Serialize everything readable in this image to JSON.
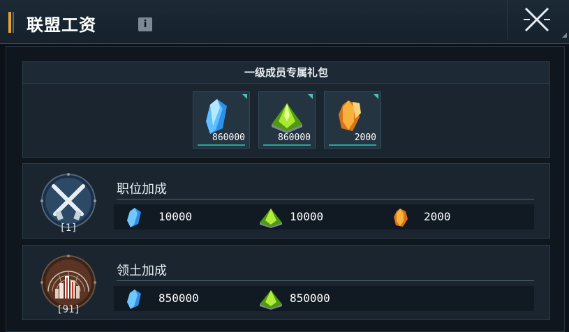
{
  "window": {
    "title": "联盟工资",
    "info_icon": "info-icon",
    "close_icon": "close-icon"
  },
  "gift_pack": {
    "title": "一级成员专属礼包",
    "items": [
      {
        "icon": "blue-crystal-icon",
        "amount": "860000"
      },
      {
        "icon": "green-crystal-icon",
        "amount": "860000"
      },
      {
        "icon": "orange-crystal-icon",
        "amount": "2000"
      }
    ]
  },
  "position_bonus": {
    "title": "职位加成",
    "emblem_icon": "crossed-guns-icon",
    "level": "[1]",
    "rewards": [
      {
        "icon": "blue-crystal-icon",
        "amount": "10000"
      },
      {
        "icon": "green-crystal-icon",
        "amount": "10000"
      },
      {
        "icon": "orange-crystal-icon",
        "amount": "2000"
      }
    ]
  },
  "territory_bonus": {
    "title": "领土加成",
    "emblem_icon": "city-dome-icon",
    "level": "[91]",
    "rewards": [
      {
        "icon": "blue-crystal-icon",
        "amount": "850000"
      },
      {
        "icon": "green-crystal-icon",
        "amount": "850000"
      }
    ]
  },
  "colors": {
    "accent": "#e8a433",
    "teal": "#27a79a",
    "panel": "#1a2530"
  }
}
